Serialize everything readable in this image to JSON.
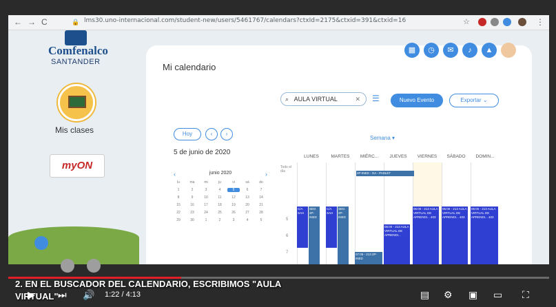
{
  "browser": {
    "url": "lms30.uno-internacional.com/student-new/users/5461767/calendars?ctxId=2175&ctxid=391&ctxid=16"
  },
  "sidebar": {
    "logo_line1": "Comfenalco",
    "logo_line2": "SANTANDER",
    "classes_label": "Mis clases",
    "myon_label": "myON"
  },
  "main": {
    "title": "Mi calendario",
    "search_value": "AULA VIRTUAL",
    "new_event_label": "Nuevo Evento",
    "export_label": "Exportar",
    "today_label": "Hoy",
    "view_label": "Semana",
    "date_label": "5 de junio de 2020",
    "mini_month": "junio 2020",
    "all_day_label": "Todo el día",
    "days": [
      "LUNES",
      "MARTES",
      "MIÉRC...",
      "JUEVES",
      "VIERNES",
      "SÁBADO",
      "DOMIN..."
    ],
    "hours": [
      "5",
      "6",
      "7"
    ],
    "allday_event": "2P-INED - OA - PADLET",
    "events": [
      "C/A SAH",
      "SEG 2P-INED",
      "C/A SAH",
      "SEG 2P-INED",
      "06:00 - 213 AULA VIRTUAL DE APRENDI...",
      "06:00 - 213 AULA VIRTUAL DE APRENDI... 403",
      "06:00 - 213 AULA VIRTUAL DE APRENDI... 403",
      "06:00 - 213 AULA VIRTUAL DE APRENDI... 403"
    ],
    "bottom_event": "07:05 - 213 2P-INED"
  },
  "player": {
    "caption": "2. EN EL BUSCADOR DEL CALENDARIO, ESCRIBIMOS \"AULA VIRTUAL\"",
    "time": "1:22 / 4:13",
    "progress": 0.32
  }
}
